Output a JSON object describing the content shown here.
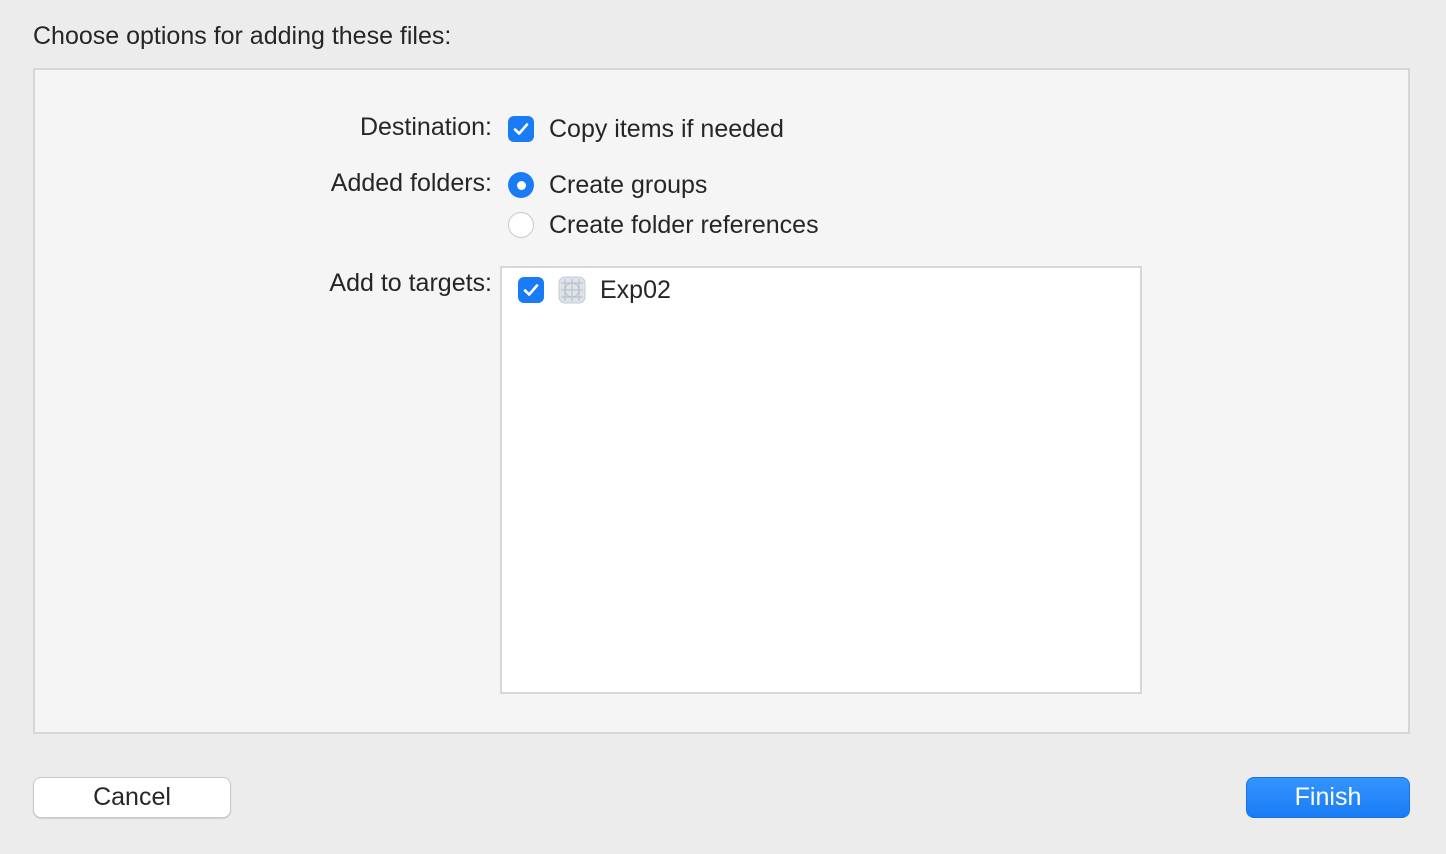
{
  "dialog": {
    "prompt": "Choose options for adding these files:"
  },
  "destination": {
    "label": "Destination:",
    "option_label": "Copy items if needed",
    "checked": true
  },
  "added_folders": {
    "label": "Added folders:",
    "options": [
      {
        "label": "Create groups",
        "selected": true
      },
      {
        "label": "Create folder references",
        "selected": false
      }
    ]
  },
  "targets": {
    "label": "Add to targets:",
    "items": [
      {
        "name": "Exp02",
        "checked": true,
        "icon": "app-target-icon"
      }
    ]
  },
  "buttons": {
    "cancel": "Cancel",
    "finish": "Finish"
  },
  "colors": {
    "accent": "#1a7cf5",
    "background": "#ececec"
  }
}
